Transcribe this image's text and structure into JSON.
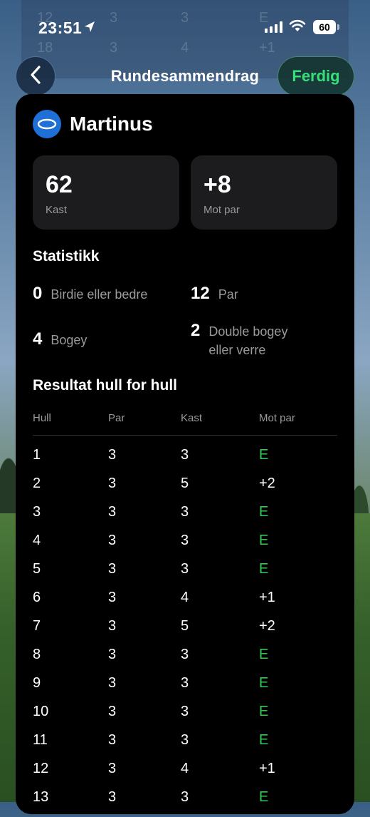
{
  "status_bar": {
    "time": "23:51",
    "battery": "60"
  },
  "background_ghost": {
    "rows": [
      [
        "12",
        "3",
        "3",
        "E"
      ],
      [
        "18",
        "3",
        "4",
        "+1"
      ]
    ]
  },
  "header": {
    "back_icon": "chevron-left-icon",
    "title": "Rundesammendrag",
    "done_label": "Ferdig"
  },
  "player": {
    "name": "Martinus",
    "icon": "disc-icon"
  },
  "summary": {
    "throws_value": "62",
    "throws_label": "Kast",
    "to_par_value": "+8",
    "to_par_label": "Mot par"
  },
  "statistics": {
    "title": "Statistikk",
    "birdie_count": "0",
    "birdie_label": "Birdie eller bedre",
    "par_count": "12",
    "par_label": "Par",
    "bogey_count": "4",
    "bogey_label": "Bogey",
    "double_count": "2",
    "double_label": "Double bogey eller verre"
  },
  "holes": {
    "title": "Resultat hull for hull",
    "columns": [
      "Hull",
      "Par",
      "Kast",
      "Mot par"
    ],
    "rows": [
      [
        "1",
        "3",
        "3",
        "E"
      ],
      [
        "2",
        "3",
        "5",
        "+2"
      ],
      [
        "3",
        "3",
        "3",
        "E"
      ],
      [
        "4",
        "3",
        "3",
        "E"
      ],
      [
        "5",
        "3",
        "3",
        "E"
      ],
      [
        "6",
        "3",
        "4",
        "+1"
      ],
      [
        "7",
        "3",
        "5",
        "+2"
      ],
      [
        "8",
        "3",
        "3",
        "E"
      ],
      [
        "9",
        "3",
        "3",
        "E"
      ],
      [
        "10",
        "3",
        "3",
        "E"
      ],
      [
        "11",
        "3",
        "3",
        "E"
      ],
      [
        "12",
        "3",
        "4",
        "+1"
      ],
      [
        "13",
        "3",
        "3",
        "E"
      ]
    ]
  },
  "colors": {
    "accent_green": "#34c759",
    "done_green": "#35e07a",
    "player_blue": "#1e6fd6"
  }
}
